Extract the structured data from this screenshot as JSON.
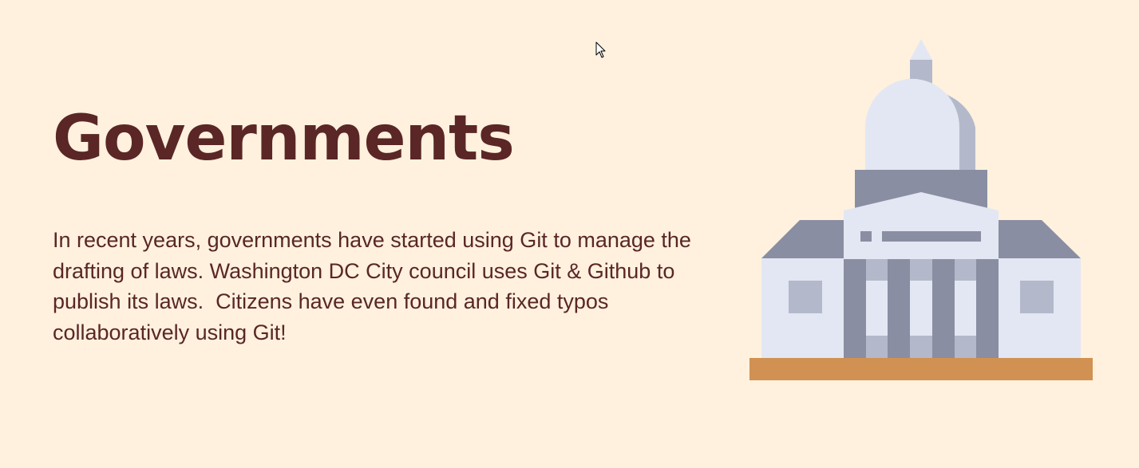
{
  "slide": {
    "title": "Governments",
    "body": "In recent years, governments have started using Git to manage the drafting of laws. Washington DC City council uses Git & Github to publish its laws.  Citizens have even found and fixed typos collaboratively using Git!"
  },
  "illustration": {
    "icon": "government-building-icon",
    "colors": {
      "background": "#FFF1DE",
      "text": "#5A2626",
      "light_stone": "#E3E7F3",
      "mid_stone": "#B3B9CA",
      "dark_stone": "#898EA2",
      "base": "#D19152"
    }
  },
  "cursor": {
    "icon": "mouse-pointer-icon"
  }
}
